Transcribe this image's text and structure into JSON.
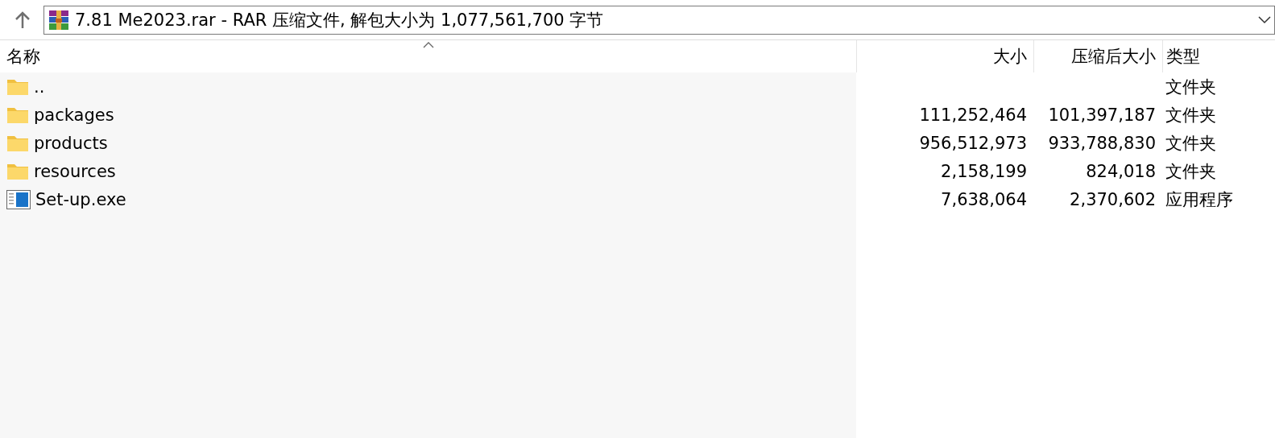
{
  "address_bar": {
    "path": "7.81 Me2023.rar - RAR 压缩文件, 解包大小为 1,077,561,700 字节"
  },
  "table": {
    "columns": [
      {
        "label": "名称",
        "sorted": true
      },
      {
        "label": "大小",
        "sorted": false
      },
      {
        "label": "压缩后大小",
        "sorted": false
      },
      {
        "label": "类型",
        "sorted": false
      }
    ],
    "rows": [
      {
        "kind": "folder",
        "name": "..",
        "type": "文件夹"
      },
      {
        "kind": "folder",
        "name": "packages",
        "size": "111,252,464",
        "packed": "101,397,187",
        "type": "文件夹"
      },
      {
        "kind": "folder",
        "name": "products",
        "size": "956,512,973",
        "packed": "933,788,830",
        "type": "文件夹"
      },
      {
        "kind": "folder",
        "name": "resources",
        "size": "2,158,199",
        "packed": "824,018",
        "type": "文件夹"
      },
      {
        "kind": "application",
        "name": "Set-up.exe",
        "size": "7,638,064",
        "packed": "2,370,602",
        "type": "应用程序"
      }
    ]
  }
}
